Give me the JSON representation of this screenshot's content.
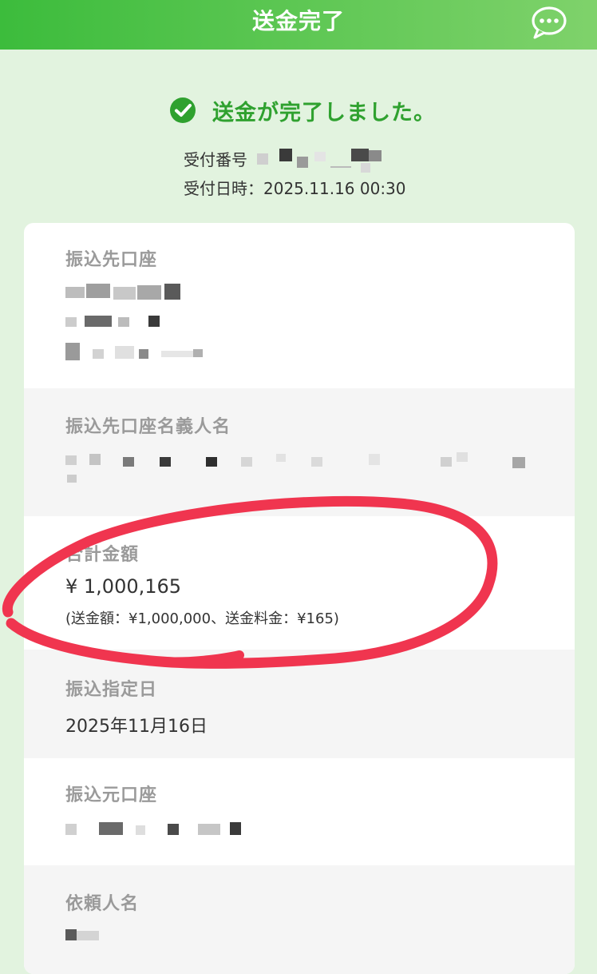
{
  "header": {
    "title": "送金完了",
    "chat_icon": "chat-bubble-icon"
  },
  "status": {
    "icon": "check-circle-icon",
    "message": "送金が完了しました。",
    "receipt_number_label": "受付番号",
    "receipt_datetime_label": "受付日時：",
    "receipt_datetime": "2025.11.16 00:30"
  },
  "details": {
    "payee_account": {
      "label": "振込先口座"
    },
    "payee_name": {
      "label": "振込先口座名義人名"
    },
    "total": {
      "label": "合計金額",
      "amount": "¥ 1,000,165",
      "breakdown": "(送金額：¥1,000,000、送金料金：¥165)"
    },
    "transfer_date": {
      "label": "振込指定日",
      "value": "2025年11月16日"
    },
    "source_account": {
      "label": "振込元口座"
    },
    "requester_name": {
      "label": "依頼人名"
    }
  },
  "colors": {
    "header_start": "#3cbc3c",
    "header_end": "#7fd26b",
    "success_green": "#2fa12f",
    "page_bg": "#e2f3df",
    "annotation_red": "#f0354f"
  }
}
